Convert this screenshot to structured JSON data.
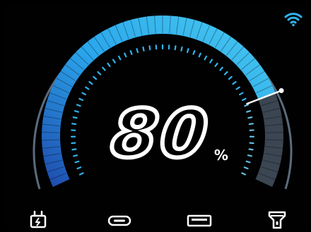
{
  "battery": {
    "level_percent": 80,
    "value_text": "80",
    "unit": "%"
  },
  "colors": {
    "accent": "#2fb4ec",
    "accent_dark": "#2160b8",
    "track_gray": "#3b4652",
    "background": "#000000"
  },
  "status_icons": [
    "wifi-icon"
  ],
  "bottom_icons": [
    "plug-charging-icon",
    "usb-c-port-icon",
    "usb-a-port-icon",
    "flashlight-icon"
  ]
}
